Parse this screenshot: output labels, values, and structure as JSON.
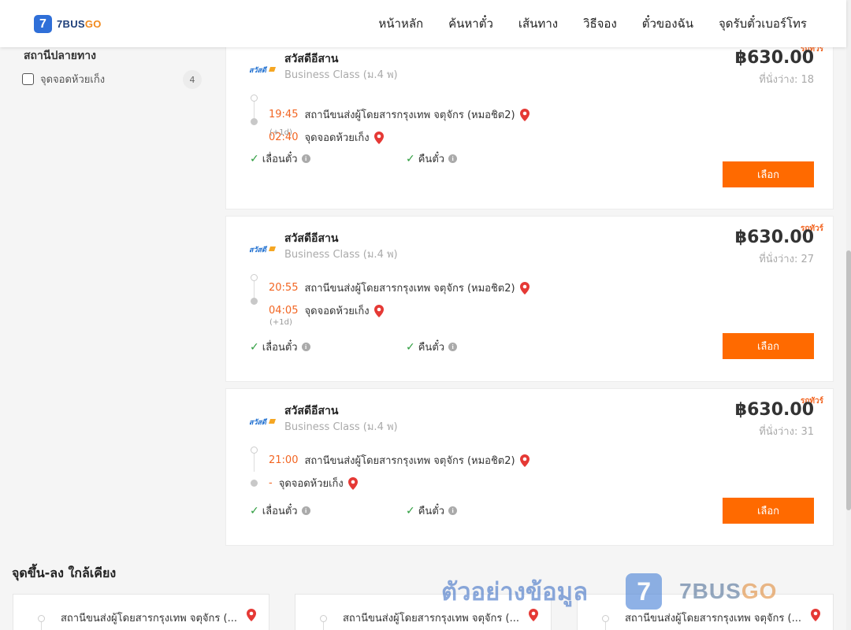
{
  "brand": {
    "badge": "7",
    "name_main": "7BUS",
    "name_accent": "GO"
  },
  "nav": [
    {
      "label": "หน้าหลัก"
    },
    {
      "label": "ค้นหาตั๋ว"
    },
    {
      "label": "เส้นทาง"
    },
    {
      "label": "วิธีจอง"
    },
    {
      "label": "ตั๋วของฉัน"
    },
    {
      "label": "จุดรับตั๋วเบอร์โทร"
    }
  ],
  "sidebar": {
    "filter_title": "สถานีปลายทาง",
    "filters": [
      {
        "label": "จุดจอดห้วยเก็ง",
        "count": "4",
        "checked": false
      }
    ]
  },
  "trips": [
    {
      "tag": "รถทัวร์",
      "operator": "สวัสดีอีสาน",
      "bus_class": "Business Class (ม.4 พ)",
      "price": "฿630.00",
      "seats": "ที่นั่งว่าง: 18",
      "depart_time": "19:45",
      "depart_station": "สถานีขนส่งผู้โดยสารกรุงเทพ จตุจักร (หมอชิต2)",
      "arrive_time": "02:40",
      "arrive_station": "จุดจอดห้วยเก็ง",
      "next_day": "(+1d)",
      "feature_1": "เลื่อนตั๋ว",
      "feature_2": "คืนตั๋ว",
      "select_label": "เลือก"
    },
    {
      "tag": "รถทัวร์",
      "operator": "สวัสดีอีสาน",
      "bus_class": "Business Class (ม.4 พ)",
      "price": "฿630.00",
      "seats": "ที่นั่งว่าง: 27",
      "depart_time": "20:55",
      "depart_station": "สถานีขนส่งผู้โดยสารกรุงเทพ จตุจักร (หมอชิต2)",
      "arrive_time": "04:05",
      "arrive_station": "จุดจอดห้วยเก็ง",
      "next_day": "(+1d)",
      "feature_1": "เลื่อนตั๋ว",
      "feature_2": "คืนตั๋ว",
      "select_label": "เลือก"
    },
    {
      "tag": "รถทัวร์",
      "operator": "สวัสดีอีสาน",
      "bus_class": "Business Class (ม.4 พ)",
      "price": "฿630.00",
      "seats": "ที่นั่งว่าง: 31",
      "depart_time": "21:00",
      "depart_station": "สถานีขนส่งผู้โดยสารกรุงเทพ จตุจักร (หมอชิต2)",
      "arrive_time": "-",
      "arrive_station": "จุดจอดห้วยเก็ง",
      "next_day": "",
      "feature_1": "เลื่อนตั๋ว",
      "feature_2": "คืนตั๋ว",
      "select_label": "เลือก"
    }
  ],
  "nearby": {
    "title": "จุดขึ้น-ลง ใกล้เคียง",
    "items": [
      {
        "station": "สถานีขนส่งผู้โดยสารกรุงเทพ จตุจักร (..."
      },
      {
        "station": "สถานีขนส่งผู้โดยสารกรุงเทพ จตุจักร (..."
      },
      {
        "station": "สถานีขนส่งผู้โดยสารกรุงเทพ จตุจักร (..."
      }
    ]
  },
  "watermark": {
    "text": "ตัวอย่างข้อมูล",
    "badge": "7",
    "brand_main": "7BUS",
    "brand_accent": "GO"
  },
  "colors": {
    "accent": "#ff6a00",
    "time": "#f26522",
    "check": "#2e9d3f",
    "pin": "#e53935",
    "logo_blue": "#2f6fd8"
  }
}
